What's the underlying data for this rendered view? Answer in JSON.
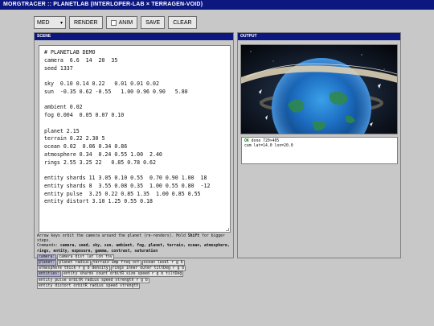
{
  "window": {
    "title": "MORGTRACER :: PLANETLAB (INTERLOPER-LAB × TERRAGEN-VOID)"
  },
  "toolbar": {
    "quality_value": "MED",
    "render_label": "RENDER",
    "anim_label": "ANIM",
    "anim_checked": false,
    "save_label": "SAVE",
    "clear_label": "CLEAR"
  },
  "scene": {
    "header": "SCENE",
    "source": "# PLANETLAB DEMO\ncamera  6.6  14  20  35\nseed 1337\n\nsky  0.10 0.14 0.22   0.01 0.01 0.02\nsun  -0.35 0.62 -0.55   1.00 0.96 0.90   5.80\n\nambient 0.02\nfog 0.004  0.05 0.07 0.10\n\nplanet 2.15\nterrain 0.22 2.30 5\nocean 0.02  0.06 0.34 0.86\natmosphere 0.34  0.24 0.55 1.00  2.40\nrings 2.55 3.25 22   0.85 0.78 0.62\n\nentity shards 11 3.05 0.10 0.55  0.70 0.90 1.00  18\nentity shards 8  3.55 0.08 0.35  1.00 0.55 0.80  -12\nentity pulse  3.25 0.22 0.85 1.35  1.00 0.85 0.55\nentity distort 3.10 1.25 0.55 0.18"
  },
  "help": {
    "intro_a": "Arrow keys orbit the camera around the planet (re-renders). Hold ",
    "intro_key": "Shift",
    "intro_b": " for bigger steps.",
    "commands_label": "Commands:",
    "commands_list": "camera, seed, sky, sun, ambient, fog, planet, terrain, ocean, atmosphere, rings, entity, exposure, gamma, contrast, saturation",
    "camera_label": "camera:",
    "camera_chip": "camera dist lat lon fov",
    "planet_label": "planet:",
    "planet_chips": [
      "planet radius",
      "terrain amp freq oct",
      "ocean level r g b",
      "atmosphere thick r g b density",
      "rings inner outer tiltDeg r g b"
    ],
    "entities_label": "entities:",
    "entity_chips": [
      "entity shards count orbitR size speed r g b tiltDeg",
      "entity pulse orbitR radius speed strength r g b",
      "entity distort orbitR radius speed strength"
    ]
  },
  "output": {
    "header": "OUTPUT",
    "status_ok": "OK",
    "status_text": " done  720×405",
    "cam_text": "cam lat=14.0 lon=20.0"
  },
  "colors": {
    "title_bar": "#0c1880",
    "panel_face": "#c8c8c8",
    "status_ok": "#138a13",
    "ocean": "#1a6ec8",
    "ring": "#d9ccb4"
  }
}
